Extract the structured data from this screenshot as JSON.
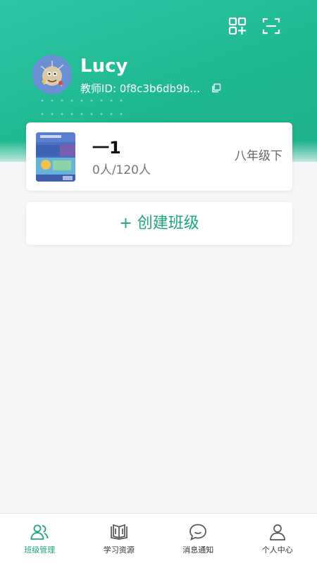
{
  "header": {
    "username": "Lucy",
    "teacher_id": "教师ID: 0f8c3b6db9b…",
    "icons": {
      "add": "qr-add-icon",
      "scan": "scan-icon",
      "copy": "copy-icon"
    }
  },
  "class_card": {
    "name": "一1",
    "count": "0人/120人",
    "grade": "八年级下"
  },
  "create_class": {
    "label": "+ 创建班级"
  },
  "tabbar": {
    "items": [
      {
        "label": "班级管理",
        "icon": "people-icon",
        "active": true
      },
      {
        "label": "学习资源",
        "icon": "book-icon",
        "active": false
      },
      {
        "label": "消息通知",
        "icon": "chat-icon",
        "active": false
      },
      {
        "label": "个人中心",
        "icon": "person-icon",
        "active": false
      }
    ]
  },
  "colors": {
    "accent": "#1ea57e",
    "header": "#22bf9a",
    "background": "#f6f7f9"
  }
}
